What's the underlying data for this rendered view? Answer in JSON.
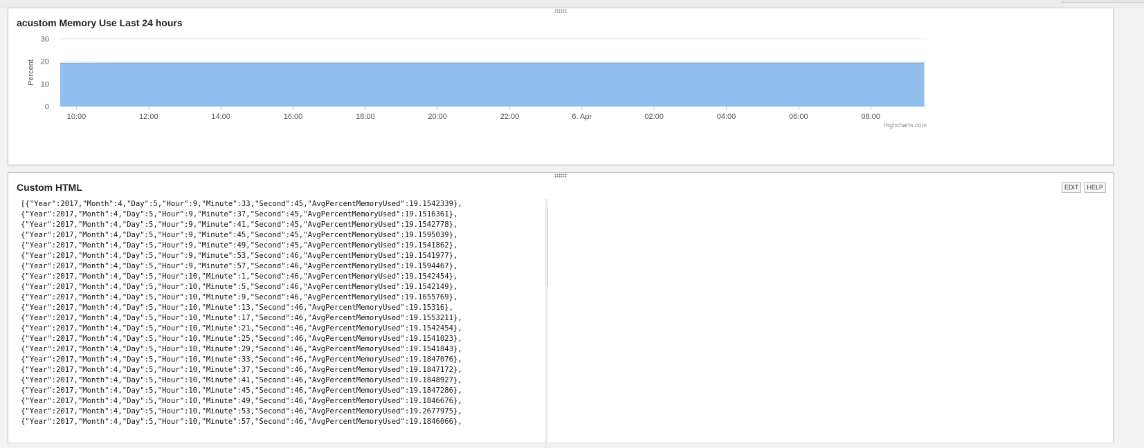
{
  "chart_panel": {
    "title": "acustom Memory Use Last 24 hours",
    "credits": "Highcharts.com"
  },
  "chart_data": {
    "type": "area",
    "title": "acustom Memory Use Last 24 hours",
    "xlabel": "",
    "ylabel": "Percent",
    "ylim": [
      0,
      30
    ],
    "y_ticks": [
      "0",
      "10",
      "20",
      "30"
    ],
    "x_range": [
      "2017-04-05 09:33",
      "2017-04-06 09:33"
    ],
    "x_ticks": [
      "10:00",
      "12:00",
      "14:00",
      "16:00",
      "18:00",
      "20:00",
      "22:00",
      "6. Apr",
      "02:00",
      "04:00",
      "06:00",
      "08:00"
    ],
    "series": [
      {
        "color": "#90bfee",
        "x": [
          "09:33",
          "12:00",
          "16:00",
          "20:00",
          "00:00",
          "04:00",
          "08:00",
          "09:29"
        ],
        "values": [
          19.15,
          19.2,
          19.2,
          19.2,
          19.2,
          19.2,
          19.2,
          19.2
        ]
      }
    ],
    "grid": true,
    "legend": "none"
  },
  "html_panel": {
    "title": "Custom HTML",
    "edit_label": "EDIT",
    "help_label": "HELP",
    "code_lines": [
      "[{\"Year\":2017,\"Month\":4,\"Day\":5,\"Hour\":9,\"Minute\":33,\"Second\":45,\"AvgPercentMemoryUsed\":19.1542339},",
      "{\"Year\":2017,\"Month\":4,\"Day\":5,\"Hour\":9,\"Minute\":37,\"Second\":45,\"AvgPercentMemoryUsed\":19.1516361},",
      "{\"Year\":2017,\"Month\":4,\"Day\":5,\"Hour\":9,\"Minute\":41,\"Second\":45,\"AvgPercentMemoryUsed\":19.1542778},",
      "{\"Year\":2017,\"Month\":4,\"Day\":5,\"Hour\":9,\"Minute\":45,\"Second\":45,\"AvgPercentMemoryUsed\":19.1595039},",
      "{\"Year\":2017,\"Month\":4,\"Day\":5,\"Hour\":9,\"Minute\":49,\"Second\":45,\"AvgPercentMemoryUsed\":19.1541862},",
      "{\"Year\":2017,\"Month\":4,\"Day\":5,\"Hour\":9,\"Minute\":53,\"Second\":46,\"AvgPercentMemoryUsed\":19.1541977},",
      "{\"Year\":2017,\"Month\":4,\"Day\":5,\"Hour\":9,\"Minute\":57,\"Second\":46,\"AvgPercentMemoryUsed\":19.1594467},",
      "{\"Year\":2017,\"Month\":4,\"Day\":5,\"Hour\":10,\"Minute\":1,\"Second\":46,\"AvgPercentMemoryUsed\":19.1542454},",
      "{\"Year\":2017,\"Month\":4,\"Day\":5,\"Hour\":10,\"Minute\":5,\"Second\":46,\"AvgPercentMemoryUsed\":19.1542149},",
      "{\"Year\":2017,\"Month\":4,\"Day\":5,\"Hour\":10,\"Minute\":9,\"Second\":46,\"AvgPercentMemoryUsed\":19.1655769},",
      "{\"Year\":2017,\"Month\":4,\"Day\":5,\"Hour\":10,\"Minute\":13,\"Second\":46,\"AvgPercentMemoryUsed\":19.15316},",
      "{\"Year\":2017,\"Month\":4,\"Day\":5,\"Hour\":10,\"Minute\":17,\"Second\":46,\"AvgPercentMemoryUsed\":19.1553211},",
      "{\"Year\":2017,\"Month\":4,\"Day\":5,\"Hour\":10,\"Minute\":21,\"Second\":46,\"AvgPercentMemoryUsed\":19.1542454},",
      "{\"Year\":2017,\"Month\":4,\"Day\":5,\"Hour\":10,\"Minute\":25,\"Second\":46,\"AvgPercentMemoryUsed\":19.1541023},",
      "{\"Year\":2017,\"Month\":4,\"Day\":5,\"Hour\":10,\"Minute\":29,\"Second\":46,\"AvgPercentMemoryUsed\":19.1541843},",
      "{\"Year\":2017,\"Month\":4,\"Day\":5,\"Hour\":10,\"Minute\":33,\"Second\":46,\"AvgPercentMemoryUsed\":19.1847076},",
      "{\"Year\":2017,\"Month\":4,\"Day\":5,\"Hour\":10,\"Minute\":37,\"Second\":46,\"AvgPercentMemoryUsed\":19.1847172},",
      "{\"Year\":2017,\"Month\":4,\"Day\":5,\"Hour\":10,\"Minute\":41,\"Second\":46,\"AvgPercentMemoryUsed\":19.1848927},",
      "{\"Year\":2017,\"Month\":4,\"Day\":5,\"Hour\":10,\"Minute\":45,\"Second\":46,\"AvgPercentMemoryUsed\":19.1847286},",
      "{\"Year\":2017,\"Month\":4,\"Day\":5,\"Hour\":10,\"Minute\":49,\"Second\":46,\"AvgPercentMemoryUsed\":19.1846676},",
      "{\"Year\":2017,\"Month\":4,\"Day\":5,\"Hour\":10,\"Minute\":53,\"Second\":46,\"AvgPercentMemoryUsed\":19.2677975},",
      "{\"Year\":2017,\"Month\":4,\"Day\":5,\"Hour\":10,\"Minute\":57,\"Second\":46,\"AvgPercentMemoryUsed\":19.1846066},"
    ]
  },
  "colors": {
    "area_fill": "#90bfee",
    "area_line": "#7fb2e6",
    "grid": "#e6e6e6"
  }
}
